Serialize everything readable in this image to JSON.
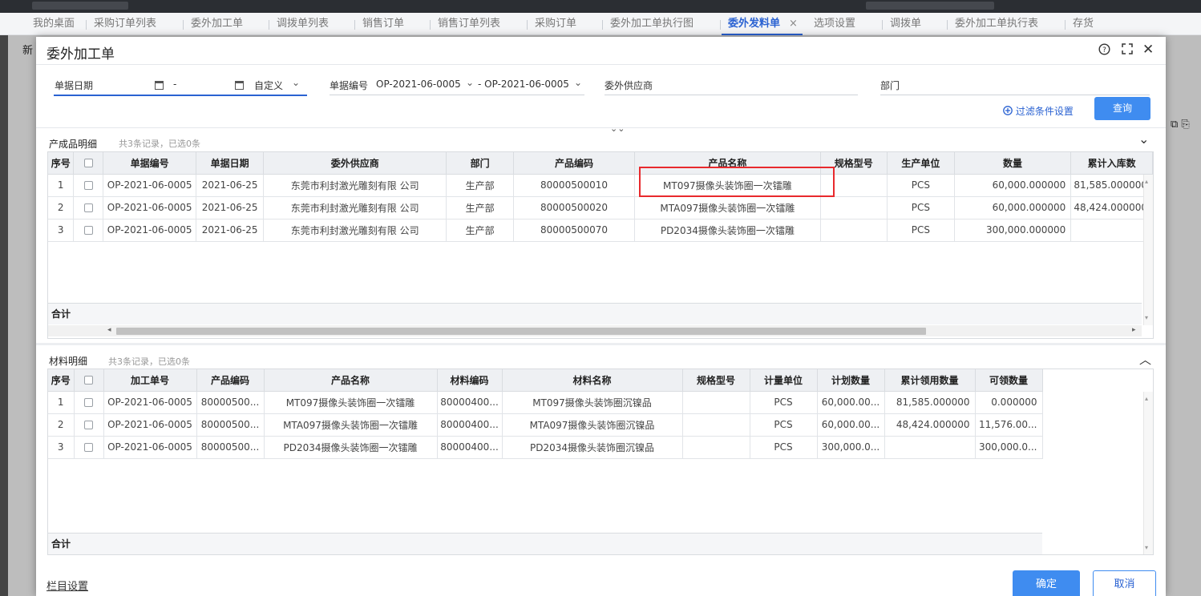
{
  "tabs": [
    {
      "label": "我的桌面"
    },
    {
      "label": "采购订单列表"
    },
    {
      "label": "委外加工单"
    },
    {
      "label": "调拨单列表"
    },
    {
      "label": "销售订单"
    },
    {
      "label": "销售订单列表"
    },
    {
      "label": "采购订单"
    },
    {
      "label": "委外加工单执行图"
    },
    {
      "label": "委外发料单",
      "active": true
    },
    {
      "label": "选项设置"
    },
    {
      "label": "调拨单"
    },
    {
      "label": "委外加工单执行表"
    },
    {
      "label": "存货"
    }
  ],
  "tab_close_glyph": "×",
  "background": {
    "new_label": "新"
  },
  "dialog": {
    "title": "委外加工单",
    "help_icon": "?",
    "expand_icon": "⛶",
    "close_icon": "✕"
  },
  "filters": {
    "date_label": "单据日期",
    "date_sep": "-",
    "date_mode": "自定义",
    "code_label": "单据编号",
    "code_from": "OP-2021-06-0005",
    "code_sep": "- OP-2021-06-0005",
    "supplier_label": "委外供应商",
    "dept_label": "部门",
    "filter_settings": "过滤条件设置",
    "query_button": "查询"
  },
  "product_section": {
    "title": "产成品明细",
    "count": "共3条记录，已选0条",
    "columns": [
      "序号",
      "",
      "单据编号",
      "单据日期",
      "委外供应商",
      "部门",
      "产品编码",
      "产品名称",
      "规格型号",
      "生产单位",
      "数量",
      "累计入库数"
    ],
    "rows": [
      [
        "1",
        "",
        "OP-2021-06-0005",
        "2021-06-25",
        "东莞市利封激光雕刻有限 公司",
        "生产部",
        "80000500010",
        "MT097摄像头装饰圈一次镭雕",
        "",
        "PCS",
        "60,000.000000",
        "81,585.000000"
      ],
      [
        "2",
        "",
        "OP-2021-06-0005",
        "2021-06-25",
        "东莞市利封激光雕刻有限 公司",
        "生产部",
        "80000500020",
        "MTA097摄像头装饰圈一次镭雕",
        "",
        "PCS",
        "60,000.000000",
        "48,424.000000"
      ],
      [
        "3",
        "",
        "OP-2021-06-0005",
        "2021-06-25",
        "东莞市利封激光雕刻有限 公司",
        "生产部",
        "80000500070",
        "PD2034摄像头装饰圈一次镭雕",
        "",
        "PCS",
        "300,000.000000",
        ""
      ]
    ],
    "sum_label": "合计"
  },
  "material_section": {
    "title": "材料明细",
    "count": "共3条记录，已选0条",
    "columns": [
      "序号",
      "",
      "加工单号",
      "产品编码",
      "产品名称",
      "材料编码",
      "材料名称",
      "规格型号",
      "计量单位",
      "计划数量",
      "累计领用数量",
      "可领数量"
    ],
    "rows": [
      [
        "1",
        "",
        "OP-2021-06-0005",
        "80000500...",
        "MT097摄像头装饰圈一次镭雕",
        "80000400...",
        "MT097摄像头装饰圈沉镍品",
        "",
        "PCS",
        "60,000.00...",
        "81,585.000000",
        "0.000000"
      ],
      [
        "2",
        "",
        "OP-2021-06-0005",
        "80000500...",
        "MTA097摄像头装饰圈一次镭雕",
        "80000400...",
        "MTA097摄像头装饰圈沉镍品",
        "",
        "PCS",
        "60,000.00...",
        "48,424.000000",
        "11,576.00..."
      ],
      [
        "3",
        "",
        "OP-2021-06-0005",
        "80000500...",
        "PD2034摄像头装饰圈一次镭雕",
        "80000400...",
        "PD2034摄像头装饰圈沉镍品",
        "",
        "PCS",
        "300,000.0...",
        "",
        "300,000.0..."
      ]
    ],
    "sum_label": "合计"
  },
  "footer": {
    "column_settings": "栏目设置",
    "confirm": "确定",
    "cancel": "取消"
  },
  "colors": {
    "accent": "#3f8cf0",
    "highlight": "#e8292d"
  }
}
